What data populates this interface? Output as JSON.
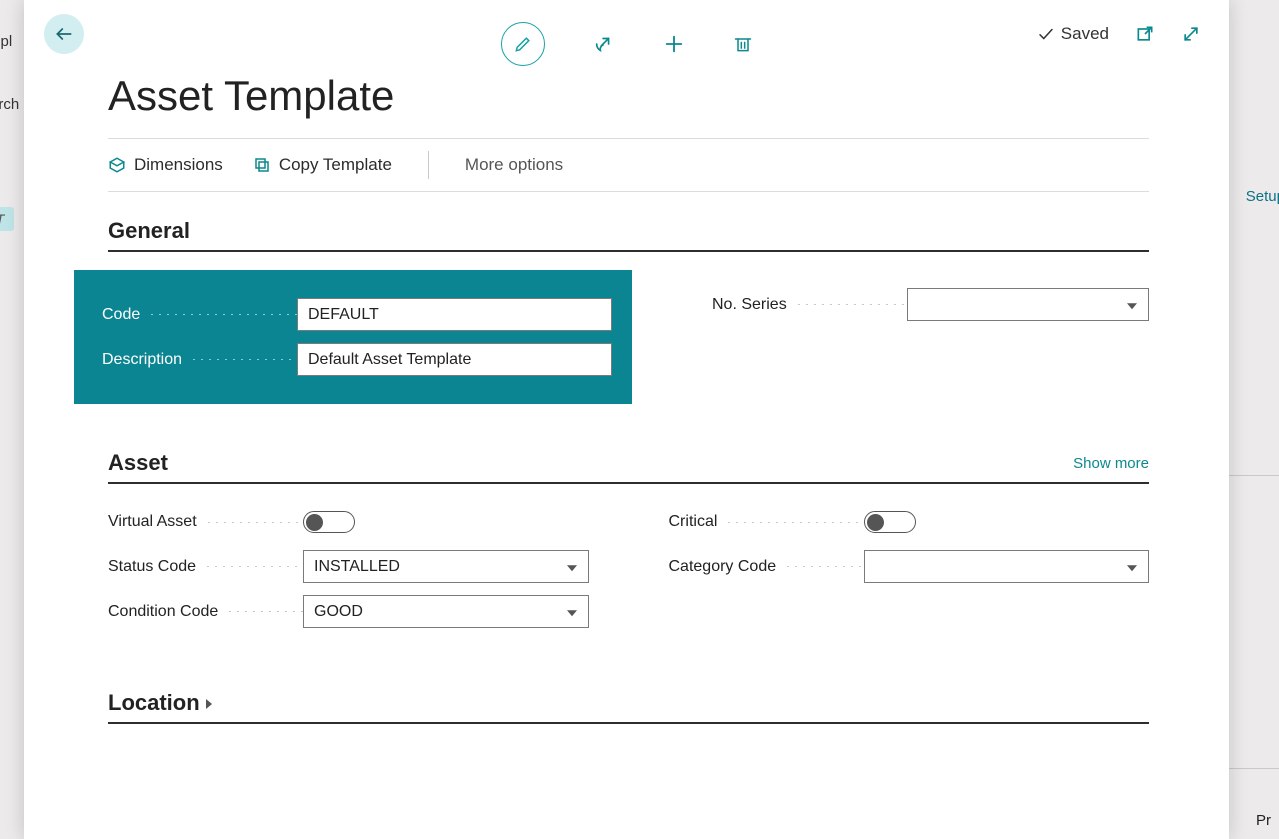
{
  "background": {
    "left_text1": "mpl",
    "left_text2": "arch",
    "left_tag": "T",
    "right_text1": "Setup",
    "right_footer": "Pr"
  },
  "header": {
    "saved_label": "Saved"
  },
  "page": {
    "title": "Asset Template"
  },
  "actions": {
    "dimensions": "Dimensions",
    "copy_template": "Copy Template",
    "more_options": "More options"
  },
  "sections": {
    "general": {
      "title": "General"
    },
    "asset": {
      "title": "Asset",
      "show_more": "Show more"
    },
    "location": {
      "title": "Location"
    }
  },
  "fields": {
    "code": {
      "label": "Code",
      "value": "DEFAULT"
    },
    "description": {
      "label": "Description",
      "value": "Default Asset Template"
    },
    "no_series": {
      "label": "No. Series",
      "value": ""
    },
    "virtual_asset": {
      "label": "Virtual Asset",
      "value": false
    },
    "critical": {
      "label": "Critical",
      "value": false
    },
    "status_code": {
      "label": "Status Code",
      "value": "INSTALLED"
    },
    "condition_code": {
      "label": "Condition Code",
      "value": "GOOD"
    },
    "category_code": {
      "label": "Category Code",
      "value": ""
    }
  }
}
